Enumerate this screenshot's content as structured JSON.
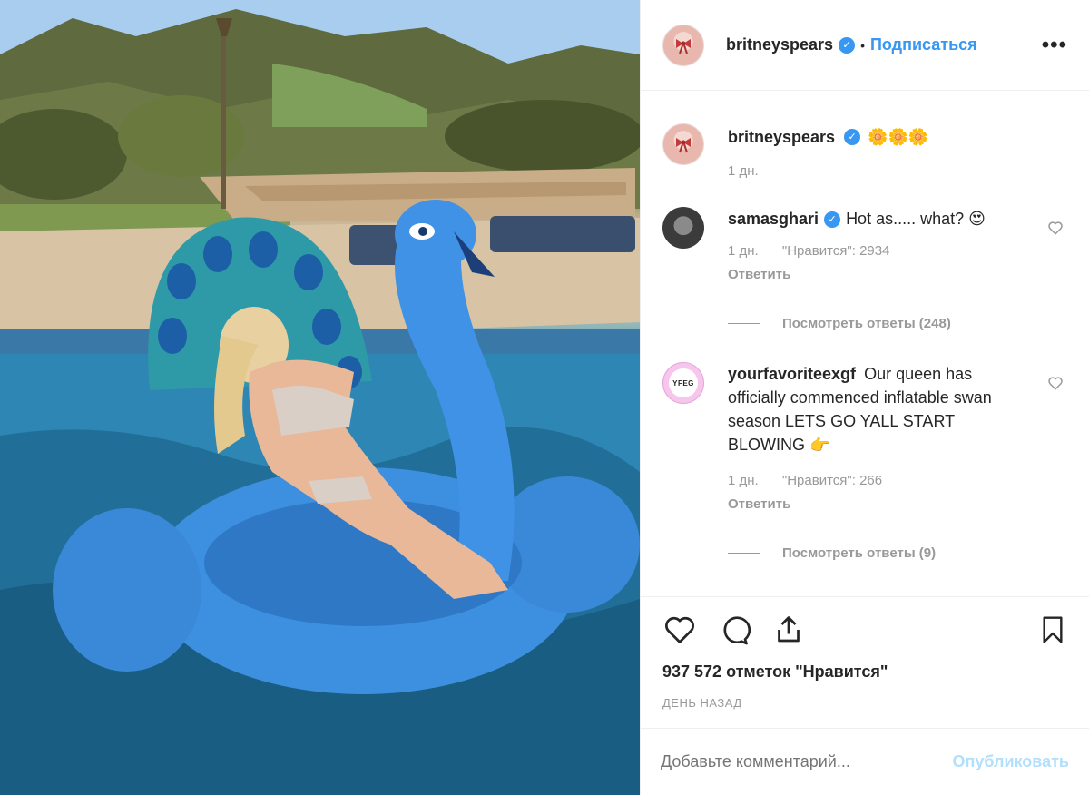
{
  "post": {
    "author": "britneyspears",
    "follow_label": "Подписаться",
    "dot": "•",
    "more_label": "•••"
  },
  "caption": {
    "username": "britneyspears",
    "text": "🌼🌼🌼",
    "age": "1 дн."
  },
  "comments": [
    {
      "username": "samasghari",
      "text": "Hot as..... what? 😍",
      "age": "1 дн.",
      "likes": "\"Нравится\": 2934",
      "reply_label": "Ответить",
      "view_replies": "Посмотреть ответы (248)",
      "verified": true
    },
    {
      "username": "yourfavoriteexgf",
      "text": "Our queen has officially commenced inflatable swan season LETS GO YALL START BLOWING 👉",
      "age": "1 дн.",
      "likes": "\"Нравится\": 266",
      "reply_label": "Ответить",
      "view_replies": "Посмотреть ответы (9)",
      "avatar_text": "YFEG",
      "verified": false
    }
  ],
  "actions": {
    "likes_count": "937 572 отметок \"Нравится\"",
    "posted": "ДЕНЬ НАЗАД"
  },
  "add_comment": {
    "placeholder": "Добавьте комментарий...",
    "publish_label": "Опубликовать"
  },
  "colors": {
    "accent": "#3897f0",
    "muted": "#999999",
    "publish_disabled": "#b2dffc"
  }
}
